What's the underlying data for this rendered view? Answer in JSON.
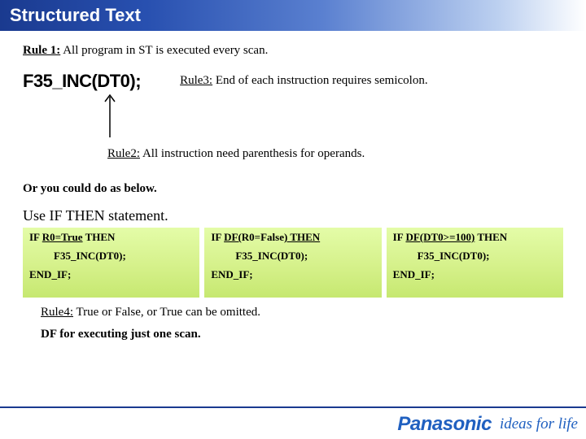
{
  "title": "Structured Text",
  "rule1": {
    "label": "Rule 1:",
    "text": "All program in ST is executed every scan."
  },
  "incCode": "F35_INC(DT0);",
  "rule3": {
    "label": "Rule3:",
    "text": "End of each instruction requires semicolon."
  },
  "rule2": {
    "label": "Rule2:",
    "text": "All instruction need parenthesis for operands."
  },
  "orLine": "Or you could do as below.",
  "useLine": "Use IF THEN statement.",
  "boxes": [
    {
      "r1_pre": "IF ",
      "r1_mid": "R0=True",
      "r1_post": " THEN",
      "r2": "F35_INC(DT0);",
      "r3": "END_IF;"
    },
    {
      "r1_pre": "IF ",
      "r1_link": "DF(",
      "r1_mid": "R0=False",
      "r1_post": ") THEN",
      "r2": "F35_INC(DT0);",
      "r3": "END_IF;"
    },
    {
      "r1_pre": "IF ",
      "r1_link": "DF(DT0>=100)",
      "r1_post": " THEN",
      "r2": "F35_INC(DT0);",
      "r3": "END_IF;"
    }
  ],
  "rule4": {
    "label": "Rule4:",
    "text": "True or False, or True can be omitted."
  },
  "dfLine": "DF for executing just one scan.",
  "logo": {
    "brand": "Panasonic",
    "tagline": "ideas for life"
  }
}
